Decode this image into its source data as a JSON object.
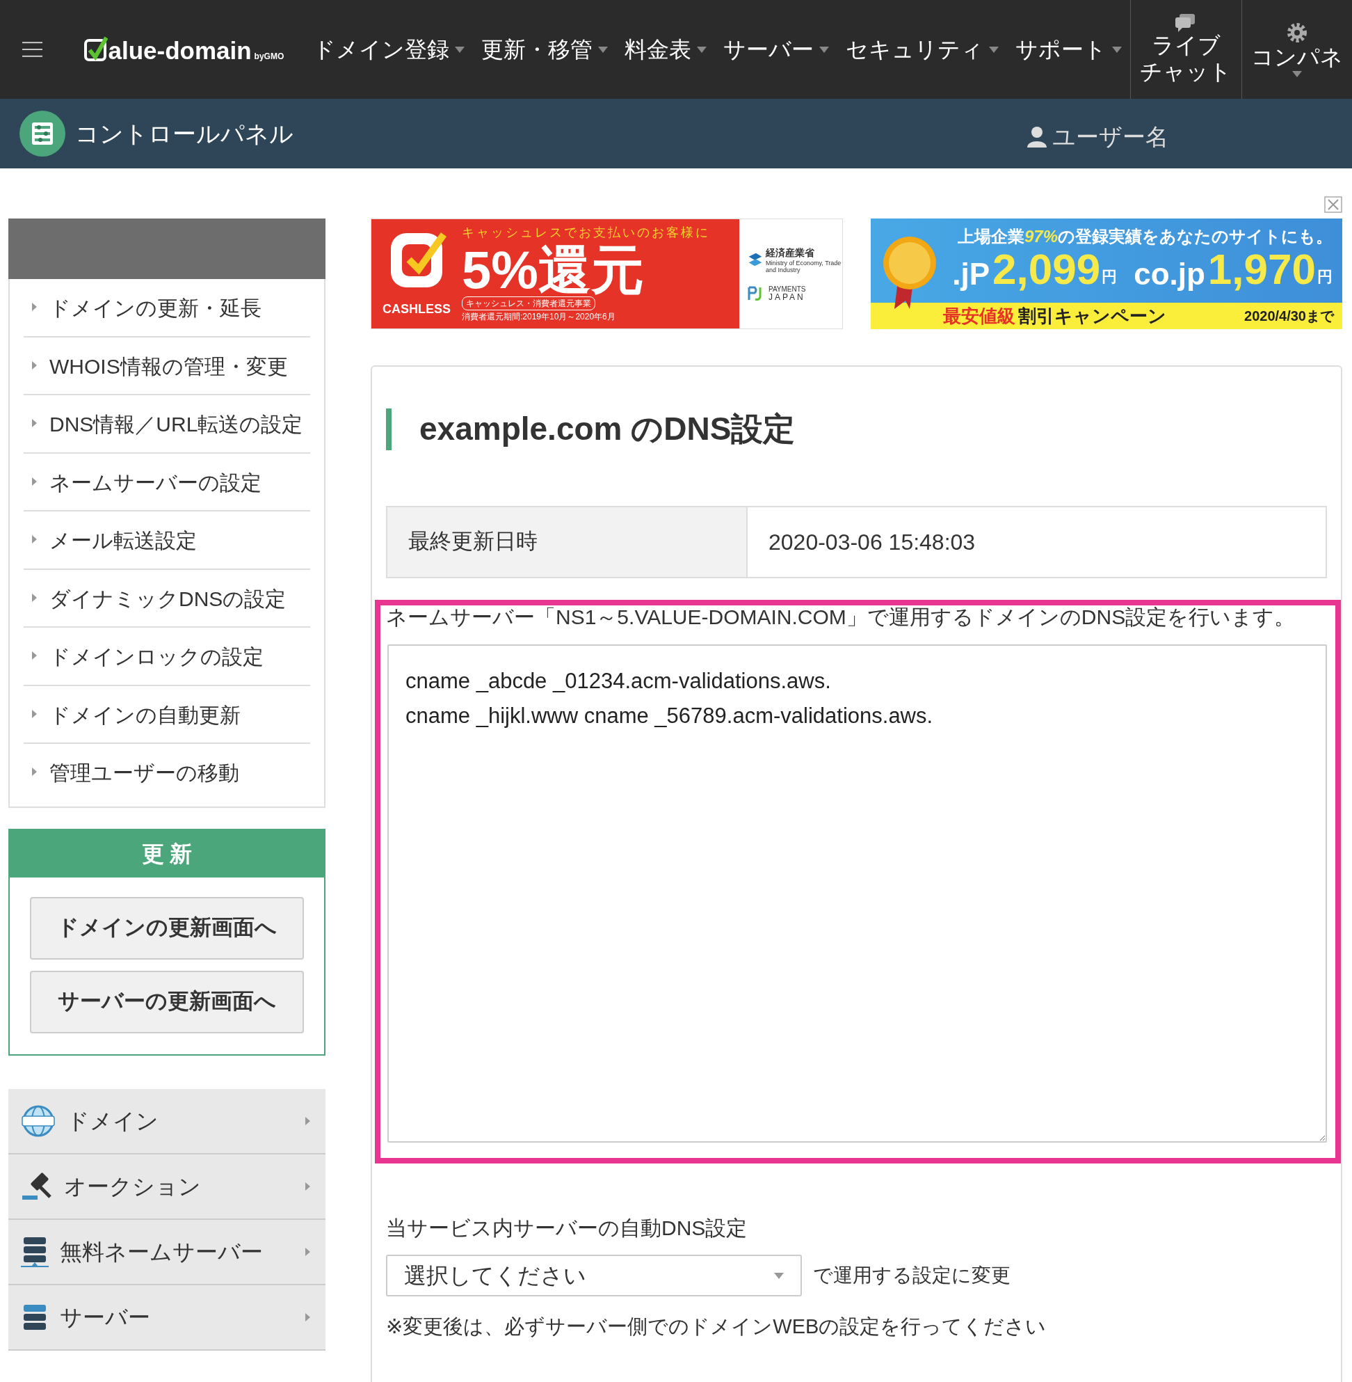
{
  "header": {
    "logo_text": "alue-domain",
    "logo_suffix": "byGMO",
    "menu_items": [
      {
        "label": "ドメイン登録",
        "has_dropdown": true
      },
      {
        "label": "更新・移管",
        "has_dropdown": true
      },
      {
        "label": "料金表",
        "has_dropdown": true
      },
      {
        "label": "サーバー",
        "has_dropdown": true
      },
      {
        "label": "セキュリティ",
        "has_dropdown": true
      },
      {
        "label": "サポート",
        "has_dropdown": true
      }
    ],
    "live_chat": {
      "lines": [
        "ライブ",
        "チャット"
      ]
    },
    "control_panel": {
      "label": "コンパネ",
      "has_dropdown": true
    }
  },
  "subheader": {
    "title": "コントロールパネル",
    "user": "ユーザー名"
  },
  "sidebar": {
    "items": [
      {
        "label": "ドメインの更新・延長"
      },
      {
        "label": "WHOIS情報の管理・変更"
      },
      {
        "label": "DNS情報／URL転送の設定"
      },
      {
        "label": "ネームサーバーの設定"
      },
      {
        "label": "メール転送設定"
      },
      {
        "label": "ダイナミックDNSの設定"
      },
      {
        "label": "ドメインロックの設定"
      },
      {
        "label": "ドメインの自動更新"
      },
      {
        "label": "管理ユーザーの移動"
      }
    ],
    "renew_panel": {
      "title": "更 新",
      "buttons": [
        "ドメインの更新画面へ",
        "サーバーの更新画面へ"
      ]
    },
    "categories": [
      {
        "label": "ドメイン",
        "kind": "domain"
      },
      {
        "label": "オークション",
        "kind": "auction"
      },
      {
        "label": "無料ネームサーバー",
        "kind": "nameserver"
      },
      {
        "label": "サーバー",
        "kind": "server"
      }
    ]
  },
  "banners": {
    "cashless": {
      "tagline": "キャッシュレスでお支払いのお客様に",
      "headline": "5%還元",
      "logo_label": "CASHLESS",
      "program": "キャッシュレス・消費者還元事業",
      "period": "消費者還元期間:2019年10月～2020年6月",
      "ministry": "経済産業省",
      "ministry_en": "Ministry of Economy, Trade and Industry",
      "payments": "PAYMENTS",
      "japan": "JAPAN"
    },
    "campaign": {
      "headline_parts": [
        {
          "text": "上場企業",
          "highlight": false
        },
        {
          "text": "97%",
          "highlight": true
        },
        {
          "text": "の登録実績をあなたのサイトにも。",
          "highlight": false
        }
      ],
      "prices": [
        {
          "tld": ".jP",
          "price": "2,099",
          "unit": "円"
        },
        {
          "tld": "co.jp",
          "price": "1,970",
          "unit": "円"
        }
      ],
      "badge": "最安値級",
      "campaign": "割引キャンペーン",
      "deadline": "2020/4/30まで"
    }
  },
  "main": {
    "title": "example.com のDNS設定",
    "info_rows": [
      {
        "label": "最終更新日時",
        "value": "2020-03-06 15:48:03"
      }
    ],
    "description": "ネームサーバー「NS1～5.VALUE-DOMAIN.COM」で運用するドメインのDNS設定を行います。",
    "dns_records": "cname _abcde _01234.acm-validations.aws.\ncname _hijkl.www cname _56789.acm-validations.aws.",
    "auto_dns_label": "当サービス内サーバーの自動DNS設定",
    "auto_dns_select": "選択してください",
    "auto_dns_suffix": "で運用する設定に変更",
    "note": "※変更後は、必ずサーバー側でのドメインWEBの設定を行ってください"
  }
}
